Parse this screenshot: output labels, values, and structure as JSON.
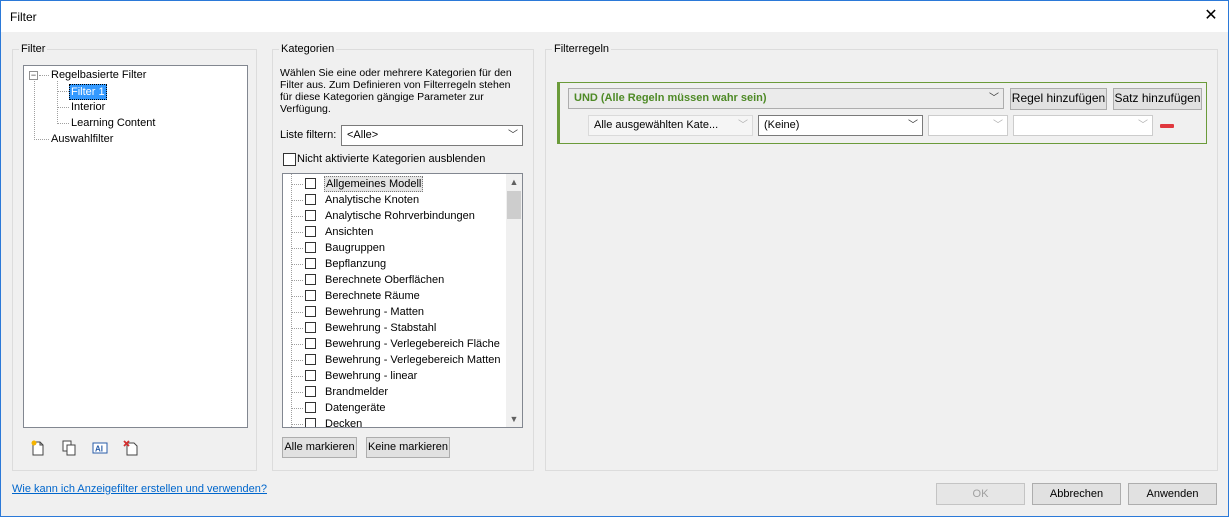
{
  "window": {
    "title": "Filter",
    "close_glyph": "✕"
  },
  "filter_panel": {
    "legend": "Filter",
    "tree": {
      "root_label": "Regelbasierte Filter",
      "children": [
        "Filter 1",
        "Interior",
        "Learning Content"
      ],
      "second_root": "Auswahlfilter"
    },
    "icons": [
      "new-filter-icon",
      "duplicate-filter-icon",
      "rename-filter-icon",
      "delete-filter-icon"
    ]
  },
  "categories_panel": {
    "legend": "Kategorien",
    "description": "Wählen Sie eine oder mehrere Kategorien für den Filter aus. Zum Definieren von Filterregeln stehen für diese Kategorien gängige Parameter zur Verfügung.",
    "filter_list_label": "Liste filtern:",
    "filter_list_value": "<Alle>",
    "hide_unchecked_label": "Nicht aktivierte Kategorien ausblenden",
    "items": [
      "Allgemeines Modell",
      "Analytische Knoten",
      "Analytische Rohrverbindungen",
      "Ansichten",
      "Baugruppen",
      "Bepflanzung",
      "Berechnete Oberflächen",
      "Berechnete Räume",
      "Bewehrung - Matten",
      "Bewehrung - Stabstahl",
      "Bewehrung - Verlegebereich Fläche",
      "Bewehrung - Verlegebereich Matten",
      "Bewehrung - linear",
      "Brandmelder",
      "Datengeräte",
      "Decken"
    ],
    "check_all_label": "Alle markieren",
    "check_none_label": "Keine markieren"
  },
  "rules_panel": {
    "legend": "Filterregeln",
    "logic_value": "UND (Alle Regeln müssen wahr sein)",
    "add_rule_label": "Regel hinzufügen",
    "add_set_label": "Satz hinzufügen",
    "rule_category_value": "Alle ausgewählten Kate...",
    "rule_param_value": "(Keine)",
    "accent_color": "#6b9b3a",
    "remove_color": "#e0383e"
  },
  "footer": {
    "help_link": "Wie kann ich Anzeigefilter erstellen und verwenden?",
    "ok_label": "OK",
    "cancel_label": "Abbrechen",
    "apply_label": "Anwenden"
  }
}
